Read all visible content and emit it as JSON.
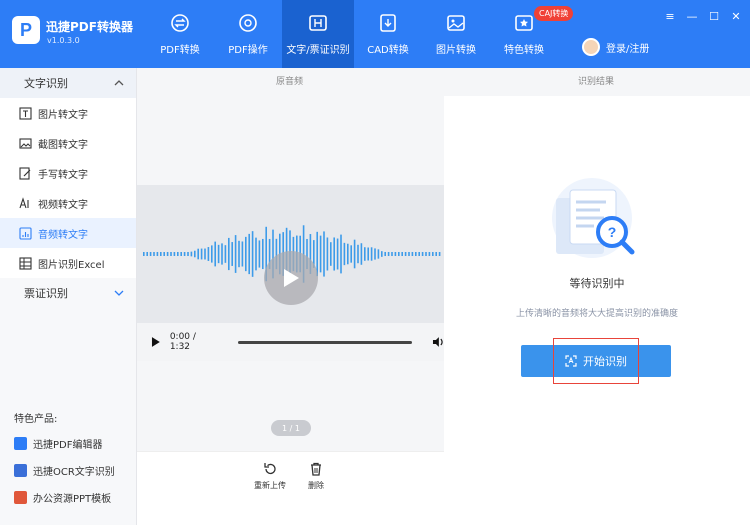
{
  "app": {
    "title": "迅捷PDF转换器",
    "version": "v1.0.3.0"
  },
  "nav": [
    {
      "label": "PDF转换",
      "icon": "pdf-convert-icon"
    },
    {
      "label": "PDF操作",
      "icon": "pdf-operate-icon"
    },
    {
      "label": "文字/票证识别",
      "icon": "ocr-icon",
      "active": true
    },
    {
      "label": "CAD转换",
      "icon": "cad-icon"
    },
    {
      "label": "图片转换",
      "icon": "image-icon"
    },
    {
      "label": "特色转换",
      "icon": "feature-icon",
      "badge": "CAJ转换"
    }
  ],
  "login": {
    "label": "登录/注册"
  },
  "window_controls": [
    "≡",
    "—",
    "☐",
    "✕"
  ],
  "sidebar": {
    "sections": [
      {
        "title": "文字识别",
        "expanded": true,
        "items": [
          {
            "label": "图片转文字",
            "icon": "text-box-icon"
          },
          {
            "label": "截图转文字",
            "icon": "screenshot-icon"
          },
          {
            "label": "手写转文字",
            "icon": "handwrite-icon"
          },
          {
            "label": "视频转文字",
            "icon": "video-text-icon"
          },
          {
            "label": "音频转文字",
            "icon": "audio-text-icon",
            "active": true
          },
          {
            "label": "图片识别Excel",
            "icon": "excel-icon"
          }
        ]
      },
      {
        "title": "票证识别",
        "expanded": false
      }
    ],
    "products_title": "特色产品:",
    "products": [
      {
        "label": "迅捷PDF编辑器",
        "color": "#2d7df6"
      },
      {
        "label": "迅捷OCR文字识别",
        "color": "#3a6fd8"
      },
      {
        "label": "办公资源PPT模板",
        "color": "#e0573a"
      }
    ]
  },
  "left_panel": {
    "heading": "原音频",
    "player": {
      "time": "0:00 / 1:32"
    },
    "pager": "1 / 1",
    "tools": [
      {
        "label": "重新上传",
        "icon": "reupload-icon"
      },
      {
        "label": "删除",
        "icon": "trash-icon"
      }
    ]
  },
  "right_panel": {
    "heading": "识别结果",
    "status": "等待识别中",
    "hint": "上传清晰的音频将大大提高识别的准确度",
    "start_button": "开始识别"
  },
  "colors": {
    "primary": "#2d7df6",
    "active_nav": "#1a62d0",
    "button": "#3a93ec",
    "highlight": "#e8443a"
  }
}
